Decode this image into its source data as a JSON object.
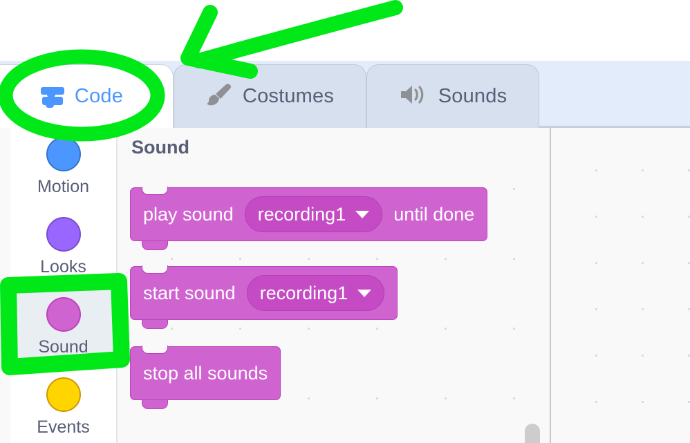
{
  "tabs": [
    {
      "id": "code",
      "label": "Code",
      "icon": "code-blocks-icon",
      "active": true,
      "color": "#4c97ff"
    },
    {
      "id": "costumes",
      "label": "Costumes",
      "icon": "paintbrush-icon",
      "active": false,
      "color": "#575e75"
    },
    {
      "id": "sounds",
      "label": "Sounds",
      "icon": "speaker-icon",
      "active": false,
      "color": "#575e75"
    }
  ],
  "categories": [
    {
      "id": "motion",
      "label": "Motion",
      "color": "#4c97ff",
      "border": "#3373cc",
      "selected": false
    },
    {
      "id": "looks",
      "label": "Looks",
      "color": "#9966ff",
      "border": "#774dcb",
      "selected": false
    },
    {
      "id": "sound",
      "label": "Sound",
      "color": "#cf63cf",
      "border": "#bd42bd",
      "selected": true
    },
    {
      "id": "events",
      "label": "Events",
      "color": "#ffd500",
      "border": "#cc9900",
      "selected": false
    }
  ],
  "palette": {
    "heading": "Sound",
    "blocks": [
      {
        "id": "play-sound-until-done",
        "parts": [
          {
            "type": "text",
            "value": "play sound"
          },
          {
            "type": "dropdown",
            "value": "recording1"
          },
          {
            "type": "text",
            "value": "until done"
          }
        ]
      },
      {
        "id": "start-sound",
        "parts": [
          {
            "type": "text",
            "value": "start sound"
          },
          {
            "type": "dropdown",
            "value": "recording1"
          }
        ]
      },
      {
        "id": "stop-all-sounds",
        "parts": [
          {
            "type": "text",
            "value": "stop all sounds"
          }
        ]
      }
    ]
  },
  "annotations": {
    "color": "#00e817",
    "marks": [
      {
        "id": "circle-around-code-tab",
        "shape": "ellipse"
      },
      {
        "id": "arrow-pointing-to-code-tab",
        "shape": "arrow"
      },
      {
        "id": "rectangle-around-sound-category",
        "shape": "rectangle"
      }
    ]
  },
  "colors": {
    "tabbar_bg": "#e2ecfb",
    "tab_inactive_bg": "#d7e0ee",
    "tab_active_bg": "#ffffff",
    "workspace_bg": "#f9f9f9",
    "block_fill": "#cf63cf",
    "block_stroke": "#bd42bd",
    "dropdown_fill": "#c44bc4",
    "text_muted": "#575e75",
    "accent_blue": "#4c97ff",
    "annotation_green": "#00e817"
  }
}
